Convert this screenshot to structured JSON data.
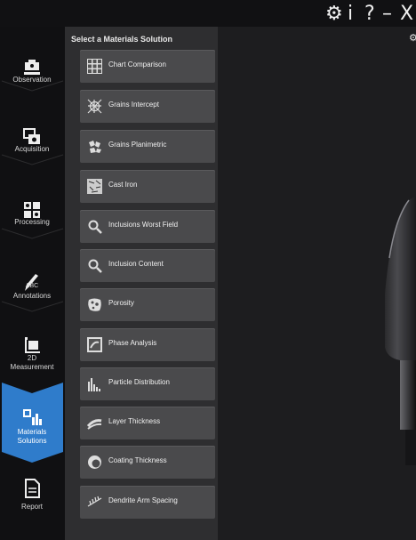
{
  "window_controls": {
    "settings": "⚙",
    "info": "i",
    "help": "?",
    "minimize": "–",
    "close": "X"
  },
  "nav": [
    {
      "label": "Observation",
      "icon": "microscope-icon"
    },
    {
      "label": "Acquisition",
      "icon": "camera-icon"
    },
    {
      "label": "Processing",
      "icon": "grid-icon"
    },
    {
      "label": "Annotations",
      "icon": "pencil-abc-icon",
      "sub": "ABC"
    },
    {
      "label": "2D",
      "label2": "Measurement",
      "icon": "measure-icon"
    },
    {
      "label": "Materials",
      "label2": "Solutions",
      "icon": "chart-icon",
      "active": true
    },
    {
      "label": "Report",
      "icon": "document-icon"
    }
  ],
  "panel": {
    "heading": "Select a Materials Solution",
    "items": [
      {
        "label": "Chart Comparison",
        "icon": "chart-comparison-icon"
      },
      {
        "label": "Grains Intercept",
        "icon": "grains-intercept-icon"
      },
      {
        "label": "Grains Planimetric",
        "icon": "grains-planimetric-icon"
      },
      {
        "label": "Cast Iron",
        "icon": "cast-iron-icon"
      },
      {
        "label": "Inclusions Worst Field",
        "icon": "magnifier-icon"
      },
      {
        "label": "Inclusion Content",
        "icon": "magnifier-icon"
      },
      {
        "label": "Porosity",
        "icon": "porosity-icon"
      },
      {
        "label": "Phase Analysis",
        "icon": "phase-analysis-icon"
      },
      {
        "label": "Particle Distribution",
        "icon": "particle-distribution-icon"
      },
      {
        "label": "Layer Thickness",
        "icon": "layer-thickness-icon"
      },
      {
        "label": "Coating Thickness",
        "icon": "coating-thickness-icon"
      },
      {
        "label": "Dendrite Arm Spacing",
        "icon": "dendrite-icon"
      }
    ]
  },
  "viewer": {
    "settings_icon": "⚙"
  }
}
